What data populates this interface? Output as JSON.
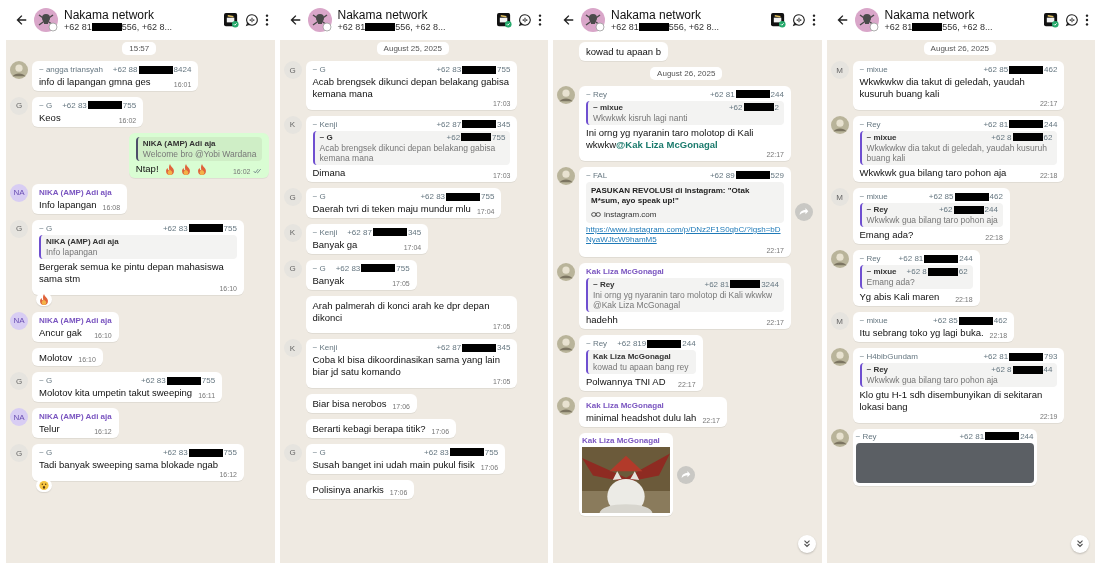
{
  "panels": [
    {
      "header": {
        "title": "Nakama network",
        "phone_prefix": "+62 81",
        "phone_suffix": "556, +62 8..."
      },
      "items": [
        {
          "kind": "date",
          "text": "15:57"
        },
        {
          "kind": "message",
          "sender": "~ angga triansyah",
          "phone": {
            "prefix": "+62 88",
            "suffix": "8424"
          },
          "text": "info di lapangan gmna ges",
          "time": "16:01"
        },
        {
          "kind": "message",
          "avatar": {
            "kind": "letter",
            "text": "G"
          },
          "sender": "~ G",
          "phone": {
            "prefix": "+62 83",
            "suffix": "755"
          },
          "text": "Keos",
          "time": "16:02"
        },
        {
          "kind": "message",
          "outgoing": true,
          "quote": {
            "sender": "NIKA (AMP) Adi aja",
            "text": "Welcome bro @Yobi Wardana"
          },
          "text": "Ntap!",
          "emojis": [
            {
              "kind": "fire"
            },
            {
              "kind": "fire"
            },
            {
              "kind": "fire"
            }
          ],
          "time": "16:02",
          "read": false
        },
        {
          "kind": "message",
          "avatar": {
            "kind": "letter",
            "text": "NA"
          },
          "saved_contact": true,
          "sender": "NIKA (AMP) Adi aja",
          "text": "Info lapangan",
          "time": "16:08"
        },
        {
          "kind": "message",
          "avatar": {
            "kind": "letter",
            "text": "G"
          },
          "sender": "~ G",
          "phone": {
            "prefix": "+62 83",
            "suffix": "755"
          },
          "quote": {
            "sender": "NIKA (AMP) Adi aja",
            "text": "Info lapangan"
          },
          "text": "Bergerak semua ke pintu depan mahasiswa sama stm",
          "time": "16:10",
          "reaction": {
            "kind": "fire"
          }
        },
        {
          "kind": "message",
          "avatar": {
            "kind": "letter",
            "text": "NA"
          },
          "saved_contact": true,
          "sender": "NIKA (AMP) Adi aja",
          "text": "Ancur gak",
          "time": "16:10"
        },
        {
          "kind": "message",
          "text": "Molotov",
          "time": "16:10"
        },
        {
          "kind": "message",
          "avatar": {
            "kind": "letter",
            "text": "G"
          },
          "sender": "~ G",
          "phone": {
            "prefix": "+62 83",
            "suffix": "755"
          },
          "text": "Molotov kita umpetin takut sweeping",
          "time": "16:11"
        },
        {
          "kind": "message",
          "avatar": {
            "kind": "letter",
            "text": "NA"
          },
          "saved_contact": true,
          "sender": "NIKA (AMP) Adi aja",
          "text": "Telur",
          "time": "16:12"
        },
        {
          "kind": "message",
          "avatar": {
            "kind": "letter",
            "text": "G"
          },
          "sender": "~ G",
          "phone": {
            "prefix": "+62 83",
            "suffix": "755"
          },
          "text": "Tadi banyak sweeping sama blokade ngab",
          "time": "16:12",
          "reaction": {
            "kind": "surprised"
          }
        }
      ]
    },
    {
      "header": {
        "title": "Nakama network",
        "phone_prefix": "+62 81",
        "phone_suffix": "556, +62 8..."
      },
      "items": [
        {
          "kind": "date",
          "text": "August 25, 2025"
        },
        {
          "kind": "message",
          "avatar": {
            "kind": "letter",
            "text": "G"
          },
          "sender": "~ G",
          "phone": {
            "prefix": "+62 83",
            "suffix": "755"
          },
          "text": "Acab brengsek dikunci depan belakang gabisa kemana mana",
          "time": "17:03"
        },
        {
          "kind": "message",
          "avatar": {
            "kind": "letter",
            "text": "K"
          },
          "sender": "~ Kenji",
          "phone": {
            "prefix": "+62 87",
            "suffix": "345"
          },
          "quote": {
            "sender": "~ G",
            "phone": {
              "prefix": "+62",
              "suffix": "755"
            },
            "text": "Acab brengsek dikunci depan belakang gabisa kemana mana"
          },
          "text": "Dimana",
          "time": "17:03"
        },
        {
          "kind": "message",
          "avatar": {
            "kind": "letter",
            "text": "G"
          },
          "sender": "~ G",
          "phone": {
            "prefix": "+62 83",
            "suffix": "755"
          },
          "text": "Daerah tvri di teken maju mundur mlu",
          "time": "17:04"
        },
        {
          "kind": "message",
          "avatar": {
            "kind": "letter",
            "text": "K"
          },
          "sender": "~ Kenji",
          "phone": {
            "prefix": "+62 87",
            "suffix": "345"
          },
          "text": "Banyak ga",
          "time": "17:04"
        },
        {
          "kind": "message",
          "avatar": {
            "kind": "letter",
            "text": "G"
          },
          "sender": "~ G",
          "phone": {
            "prefix": "+62 83",
            "suffix": "755"
          },
          "text": "Banyak",
          "time": "17:05"
        },
        {
          "kind": "message",
          "text": "Arah palmerah di konci arah ke dpr depan dikonci",
          "time": "17:05"
        },
        {
          "kind": "message",
          "avatar": {
            "kind": "letter",
            "text": "K"
          },
          "sender": "~ Kenji",
          "phone": {
            "prefix": "+62 87",
            "suffix": "345"
          },
          "text": "Coba kl bisa dikoordinasikan sama yang lain biar jd satu komando",
          "time": "17:05"
        },
        {
          "kind": "message",
          "text": "Biar bisa nerobos",
          "time": "17:06"
        },
        {
          "kind": "message",
          "text": "Berarti kebagi berapa titik?",
          "time": "17:06"
        },
        {
          "kind": "message",
          "avatar": {
            "kind": "letter",
            "text": "G"
          },
          "sender": "~ G",
          "phone": {
            "prefix": "+62 83",
            "suffix": "755"
          },
          "text": "Susah banget ini udah main pukul fisik",
          "time": "17:06"
        },
        {
          "kind": "message",
          "text": "Polisinya anarkis",
          "time": "17:06"
        }
      ]
    },
    {
      "header": {
        "title": "Nakama network",
        "phone_prefix": "+62 81",
        "phone_suffix": "556, +62 8..."
      },
      "scroll_down_button": true,
      "items": [
        {
          "kind": "partial",
          "text": "kowad tu apaan b"
        },
        {
          "kind": "date",
          "text": "August 26, 2025"
        },
        {
          "kind": "message",
          "sender": "~ Rey",
          "phone": {
            "prefix": "+62 81",
            "suffix": "244"
          },
          "quote": {
            "sender": "~ mixue",
            "phone": {
              "prefix": "+62",
              "suffix": "2"
            },
            "text": "Wkwkwk kisruh lagi nanti"
          },
          "text": "Ini orng yg nyaranin taro molotop di Kali wkwkw",
          "mention": "@Kak Liza McGonagal",
          "time": "22:17"
        },
        {
          "kind": "message",
          "sender": "~ FAL",
          "phone": {
            "prefix": "+62 89",
            "suffix": "529"
          },
          "preview": {
            "title": "PASUKAN REVOLUSI di Instagram: \"Otak M*sum, ayo speak up!\"",
            "domain": "instagram.com"
          },
          "link": "https://www.instagram.com/p/DNz2F1S0qbC/?igsh=bDNyaWJtcW9hamM5",
          "time": "22:17",
          "forward": true
        },
        {
          "kind": "message",
          "saved_contact": true,
          "sender": "Kak Liza McGonagal",
          "quote": {
            "sender": "~ Rey",
            "phone": {
              "prefix": "+62 81",
              "suffix": "3244"
            },
            "text": "Ini orng yg nyaranin taro molotop di Kali wkwkw @Kak Liza McGonagal"
          },
          "text": "hadehh",
          "time": "22:17"
        },
        {
          "kind": "message",
          "sender": "~ Rey",
          "phone": {
            "prefix": "+62 819",
            "suffix": "244"
          },
          "quote": {
            "sender": "Kak Liza McGonagal",
            "text": "kowad tu apaan bang rey"
          },
          "text": "Polwannya TNI AD",
          "time": "22:17"
        },
        {
          "kind": "message",
          "saved_contact": true,
          "sender": "Kak Liza McGonagal",
          "text": "minimal headshot dulu lah",
          "time": "22:17"
        },
        {
          "kind": "message",
          "saved_contact": true,
          "sender": "Kak Liza McGonagal",
          "forward": true
        }
      ]
    },
    {
      "header": {
        "title": "Nakama network",
        "phone_prefix": "+62 81",
        "phone_suffix": "556, +62 8..."
      },
      "scroll_down_button": true,
      "items": [
        {
          "kind": "date",
          "text": "August 26, 2025"
        },
        {
          "kind": "message",
          "avatar": {
            "kind": "letter",
            "text": "M"
          },
          "sender": "~ mixue",
          "phone": {
            "prefix": "+62 85",
            "suffix": "462"
          },
          "text": "Wkwkwkw dia takut di geledah, yaudah kusuruh buang kali",
          "time": "22:17"
        },
        {
          "kind": "message",
          "sender": "~ Rey",
          "phone": {
            "prefix": "+62 81",
            "suffix": "244"
          },
          "quote": {
            "sender": "~ mixue",
            "phone": {
              "prefix": "+62 8",
              "suffix": "62"
            },
            "text": "Wkwkwkw dia takut di geledah, yaudah kusuruh buang kali"
          },
          "text": "Wkwkwk gua bilang taro pohon aja",
          "time": "22:18"
        },
        {
          "kind": "message",
          "avatar": {
            "kind": "letter",
            "text": "M"
          },
          "sender": "~ mixue",
          "phone": {
            "prefix": "+62 85",
            "suffix": "462"
          },
          "quote": {
            "sender": "~ Rey",
            "phone": {
              "prefix": "+62",
              "suffix": "244"
            },
            "text": "Wkwkwk gua bilang taro pohon aja"
          },
          "text": "Emang ada?",
          "time": "22:18"
        },
        {
          "kind": "message",
          "sender": "~ Rey",
          "phone": {
            "prefix": "+62 81",
            "suffix": "244"
          },
          "quote": {
            "sender": "~ mixue",
            "phone": {
              "prefix": "+62 8",
              "suffix": "62"
            },
            "text": "Emang ada?"
          },
          "text": "Yg abis Kali maren",
          "time": "22:18"
        },
        {
          "kind": "message",
          "avatar": {
            "kind": "letter",
            "text": "M"
          },
          "sender": "~ mixue",
          "phone": {
            "prefix": "+62 85",
            "suffix": "462"
          },
          "text": "Itu sebrang toko yg lagi buka.",
          "time": "22:18"
        },
        {
          "kind": "message",
          "sender": "~ H4bibGundam",
          "phone": {
            "prefix": "+62 81",
            "suffix": "793"
          },
          "quote": {
            "sender": "~ Rey",
            "phone": {
              "prefix": "+62 8",
              "suffix": "44"
            },
            "text": "Wkwkwk gua bilang taro pohon aja"
          },
          "text": "Klo gtu H-1 sdh disembunyikan di sekitaran lokasi bang",
          "time": "22:19"
        },
        {
          "kind": "message",
          "sender": "~ Rey",
          "phone": {
            "prefix": "+62 81",
            "suffix": "244"
          },
          "media": {
            "kind": "placeholder"
          }
        }
      ]
    }
  ]
}
